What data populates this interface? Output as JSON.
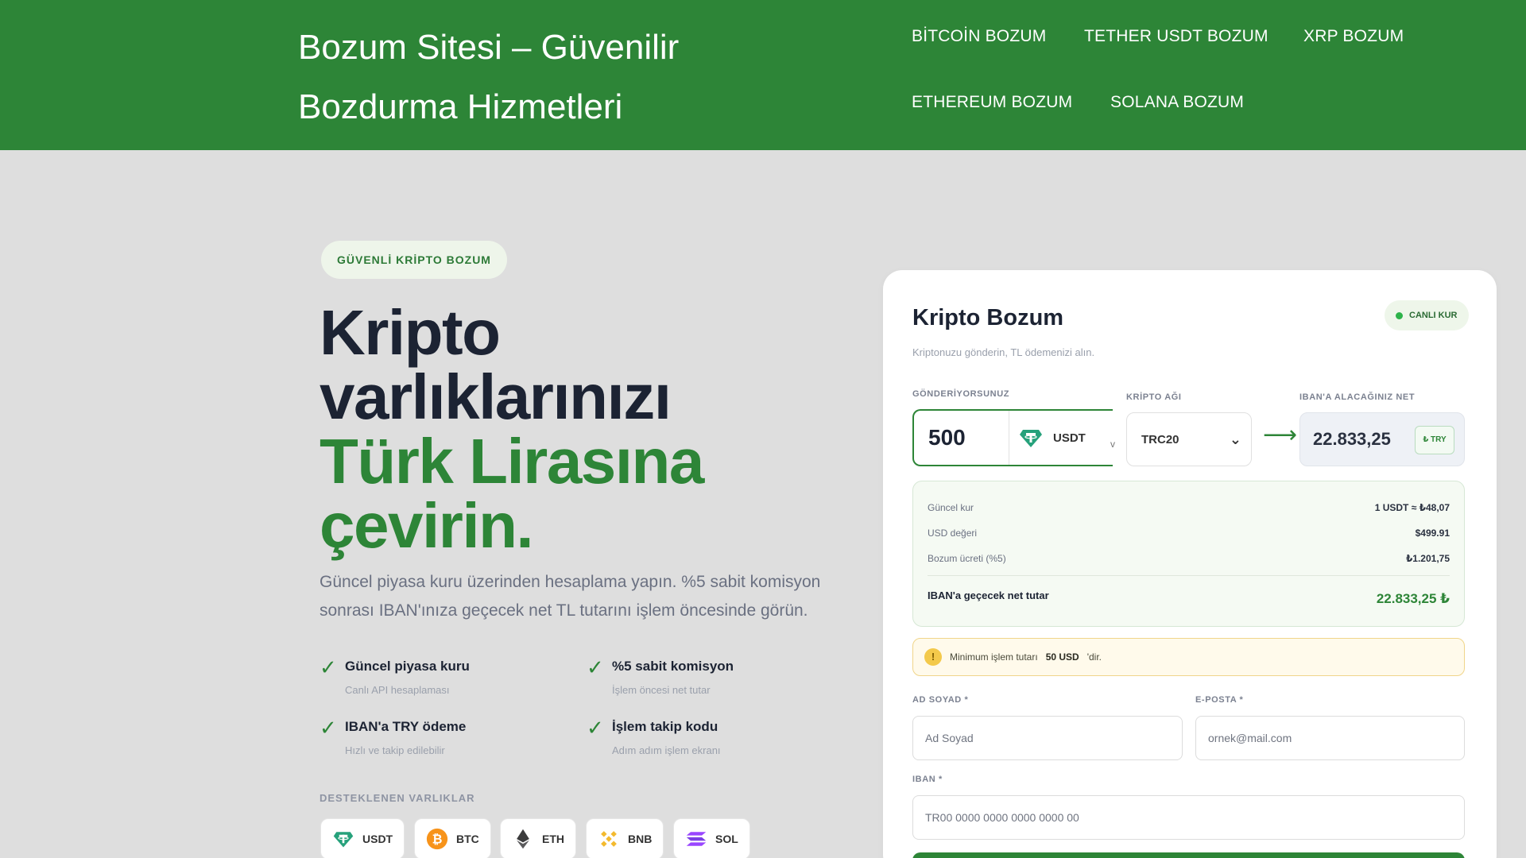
{
  "header": {
    "site_title": "Bozum Sitesi – Güvenilir Bozdurma Hizmetleri",
    "nav": [
      "BİTCOİN BOZUM",
      "TETHER USDT BOZUM",
      "XRP BOZUM",
      "ETHEREUM BOZUM",
      "SOLANA BOZUM"
    ]
  },
  "hero": {
    "badge": "GÜVENLİ KRİPTO BOZUM",
    "headline_dark": [
      "Kripto",
      "varlıklarınızı"
    ],
    "headline_green": [
      "Türk Lirasına",
      "çevirin."
    ],
    "lead": "Güncel piyasa kuru üzerinden hesaplama yapın. %5 sabit komisyon sonrası IBAN'ınıza geçecek net TL tutarını işlem öncesinde görün.",
    "check_icon": "✓",
    "features": [
      {
        "title": "Güncel piyasa kuru",
        "subtitle": "Canlı API hesaplaması"
      },
      {
        "title": "%5 sabit komisyon",
        "subtitle": "İşlem öncesi net tutar"
      },
      {
        "title": "IBAN'a TRY ödeme",
        "subtitle": "Hızlı ve takip edilebilir"
      },
      {
        "title": "İşlem takip kodu",
        "subtitle": "Adım adım işlem ekranı"
      }
    ],
    "supported_label": "DESTEKLENEN VARLIKLAR",
    "assets": [
      {
        "label": "USDT",
        "icon": "tether-icon",
        "color": "#26a17b"
      },
      {
        "label": "BTC",
        "icon": "bitcoin-icon",
        "color": "#f7931a"
      },
      {
        "label": "ETH",
        "icon": "ethereum-icon",
        "color": "#3c3c3d"
      },
      {
        "label": "BNB",
        "icon": "bnb-icon",
        "color": "#f3ba2f"
      },
      {
        "label": "SOL",
        "icon": "solana-icon",
        "color": "#9945ff"
      }
    ]
  },
  "card": {
    "title": "Kripto Bozum",
    "live_badge": "CANLI KUR",
    "subtitle": "Kriptonuzu gönderin, TL ödemenizi alın.",
    "send_label": "GÖNDERİYORSUNUZ",
    "amount": "500",
    "coin": "USDT",
    "caret": "v",
    "network_label": "KRİPTO AĞI",
    "network": "TRC20",
    "network_caret": "⌄",
    "arrow": "⟶",
    "net_label": "IBAN'A ALACAĞINIZ NET",
    "net_value": "22.833,25",
    "net_currency": "₺ TRY",
    "summary": {
      "rows": [
        {
          "label": "Güncel kur",
          "value": "1 USDT ≈ ₺48,07"
        },
        {
          "label": "USD değeri",
          "value": "$499.91"
        },
        {
          "label": "Bozum ücreti (%5)",
          "value": "₺1.201,75"
        }
      ],
      "total_label": "IBAN'a geçecek net tutar",
      "total_value": "22.833,25 ₺"
    },
    "notice": {
      "icon": "!",
      "prefix": "Minimum işlem tutarı",
      "amount": "50 USD",
      "suffix": "'dir."
    },
    "name_label": "AD SOYAD *",
    "name_placeholder": "Ad Soyad",
    "email_label": "E-POSTA *",
    "email_placeholder": "ornek@mail.com",
    "iban_label": "IBAN *",
    "iban_placeholder": "TR00 0000 0000 0000 0000 00"
  },
  "colors": {
    "brand_green": "#2d8537",
    "background": "#dedede",
    "ink": "#1c2333"
  }
}
